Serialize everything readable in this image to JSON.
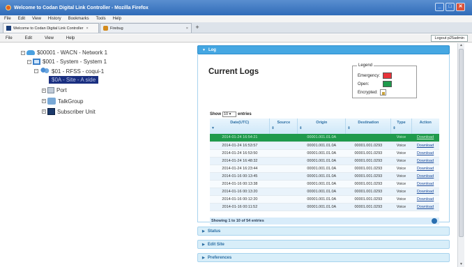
{
  "window": {
    "title": "Welcome to Codan Digital Link Controller - Mozilla Firefox",
    "min": "_",
    "max": "□",
    "close": "✕"
  },
  "menu": [
    "File",
    "Edit",
    "View",
    "History",
    "Bookmarks",
    "Tools",
    "Help"
  ],
  "tabs": [
    {
      "label": "Welcome to Codan Digital Link Controller",
      "close": "×"
    },
    {
      "label": "Firebug",
      "close": "×"
    }
  ],
  "new_tab": "+",
  "app_menu": [
    "File",
    "Edit",
    "View",
    "Help"
  ],
  "logout": "Logout p25admin",
  "tree": {
    "n1": {
      "label": "$00001 - WACN - Network 1",
      "exp": "−"
    },
    "n2": {
      "label": "$001 - System - System 1",
      "exp": "−"
    },
    "n3": {
      "label": "$01 - RFSS - coqui-1",
      "exp": "−"
    },
    "n4": {
      "label": "$0A - Site - A side"
    },
    "n5": {
      "label": "Port",
      "exp": "+"
    },
    "n6": {
      "label": "TalkGroup",
      "exp": "+"
    },
    "n7": {
      "label": "Subscriber Unit",
      "exp": "+"
    }
  },
  "log_panel": {
    "header": "Log",
    "tri": "▼",
    "title": "Current Logs",
    "legend": {
      "title": "Legend",
      "emergency": "Emergency:",
      "open": "Open:",
      "encrypted": "Encrypted:",
      "colors": {
        "emergency": "#e8333a",
        "open": "#1f9a4c"
      }
    },
    "show": {
      "prefix": "Show",
      "value": "10 ▾",
      "suffix": "entries"
    },
    "columns": [
      "Date(UTC)",
      "Source",
      "Origin",
      "Destination",
      "Type",
      "Action"
    ],
    "sort_glyph": "⇕",
    "sort_glyph_first": "▼",
    "rows": [
      [
        "2014-01-24 16:54:21",
        "",
        "00001.001.01.0A",
        "",
        "Voice",
        "Download"
      ],
      [
        "2014-01-24 16:53:57",
        "",
        "00001.001.01.0A",
        "00001.001.0293",
        "Voice",
        "Download"
      ],
      [
        "2014-01-24 16:53:50",
        "",
        "00001.001.01.0A",
        "00001.001.0293",
        "Voice",
        "Download"
      ],
      [
        "2014-01-24 16:48:32",
        "",
        "00001.001.01.0A",
        "00001.001.0293",
        "Voice",
        "Download"
      ],
      [
        "2014-01-24 16:23:44",
        "",
        "00001.001.01.0A",
        "00001.001.0293",
        "Voice",
        "Download"
      ],
      [
        "2014-01-16 00:13:45",
        "",
        "00001.001.01.0A",
        "00001.001.0293",
        "Voice",
        "Download"
      ],
      [
        "2014-01-16 00:13:38",
        "",
        "00001.001.01.0A",
        "00001.001.0293",
        "Voice",
        "Download"
      ],
      [
        "2014-01-16 00:13:20",
        "",
        "00001.001.01.0A",
        "00001.001.0293",
        "Voice",
        "Download"
      ],
      [
        "2014-01-16 00:12:20",
        "",
        "00001.001.01.0A",
        "00001.001.0293",
        "Voice",
        "Download"
      ],
      [
        "2014-01-16 00:11:52",
        "",
        "00001.001.01.0A",
        "00001.001.0293",
        "Voice",
        "Download"
      ]
    ],
    "footer": "Showing 1 to 10 of 54 entries"
  },
  "sections": [
    {
      "label": "Status",
      "tri": "▶"
    },
    {
      "label": "Edit Site",
      "tri": "▶"
    },
    {
      "label": "Preferences",
      "tri": "▶"
    }
  ],
  "scroll": {
    "up": "▲",
    "down": "▼"
  }
}
